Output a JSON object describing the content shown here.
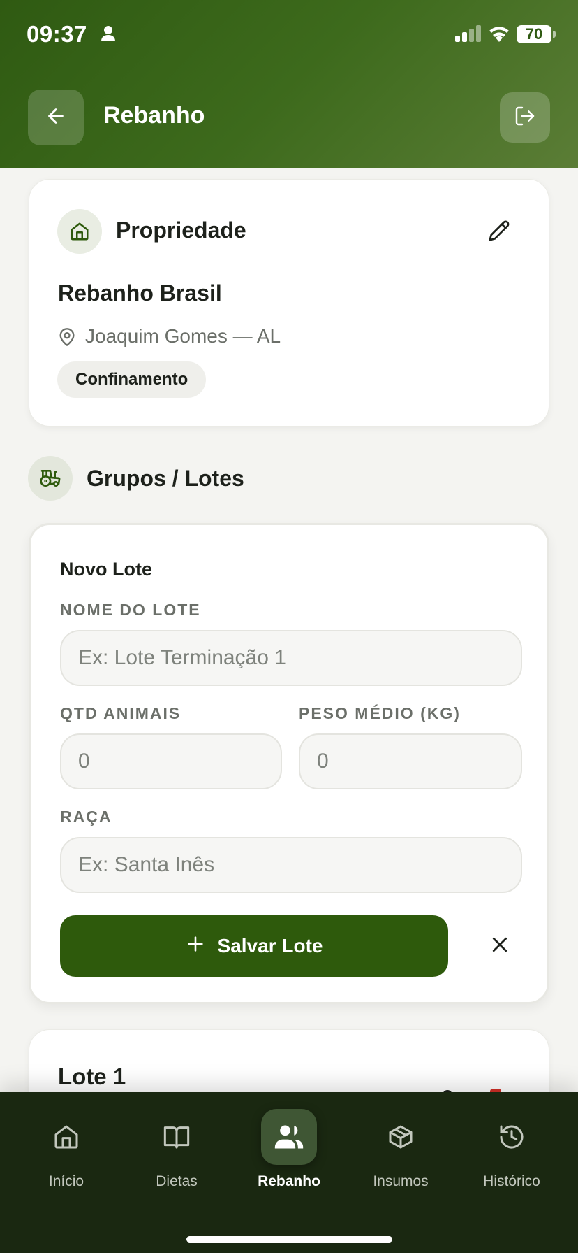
{
  "status_bar": {
    "time": "09:37",
    "battery": "70"
  },
  "header": {
    "title": "Rebanho",
    "back_icon": "arrow-left-icon",
    "logout_icon": "logout-icon"
  },
  "property": {
    "label": "Propriedade",
    "name": "Rebanho Brasil",
    "location": "Joaquim Gomes — AL",
    "badge": "Confinamento"
  },
  "groups": {
    "title": "Grupos / Lotes"
  },
  "form": {
    "title": "Novo Lote",
    "name_label": "NOME DO LOTE",
    "name_placeholder": "Ex: Lote Terminação 1",
    "qty_label": "QTD ANIMAIS",
    "qty_placeholder": "0",
    "weight_label": "PESO MÉDIO (KG)",
    "weight_placeholder": "0",
    "breed_label": "RAÇA",
    "breed_placeholder": "Ex: Santa Inês",
    "save_label": "Salvar Lote"
  },
  "lotes": [
    {
      "title": "Lote 1"
    }
  ],
  "nav": {
    "items": [
      {
        "label": "Início",
        "icon": "home-icon"
      },
      {
        "label": "Dietas",
        "icon": "book-icon"
      },
      {
        "label": "Rebanho",
        "icon": "users-icon",
        "active": true
      },
      {
        "label": "Insumos",
        "icon": "box-icon"
      },
      {
        "label": "Histórico",
        "icon": "history-icon"
      }
    ]
  },
  "colors": {
    "primary": "#2e5a0c",
    "header_start": "#2f5a12",
    "nav_bg": "#1a2811",
    "delete": "#d22f27"
  }
}
